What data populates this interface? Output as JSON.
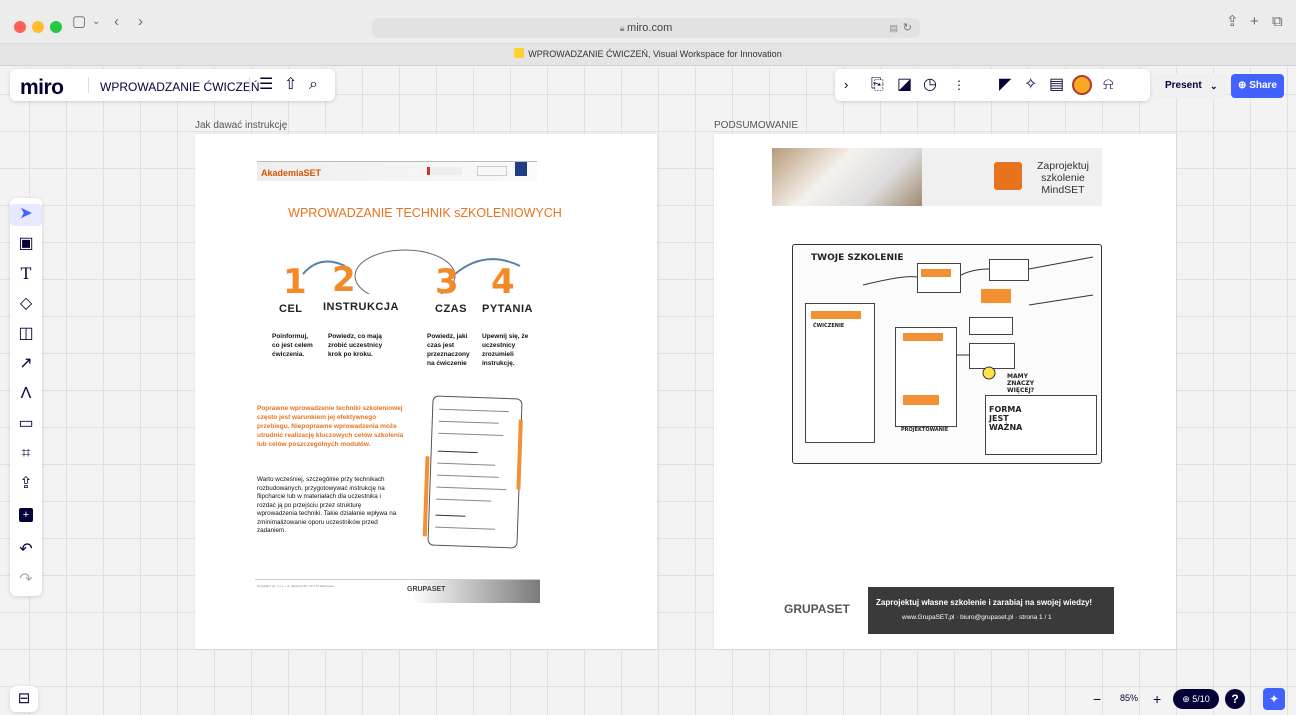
{
  "browser": {
    "url": "miro.com",
    "tab_title": "WPROWADZANIE ĆWICZEŃ, Visual Workspace for Innovation",
    "traffic_colors": [
      "#ff5f57",
      "#febc2e",
      "#28c840"
    ]
  },
  "toolbar": {
    "logo": "miro",
    "board_title": "WPROWADZANIE ĆWICZEŃ",
    "present_label": "Present",
    "share_label": "Share"
  },
  "frames": {
    "left_label": "Jak dawać instrukcję",
    "right_label": "PODSUMOWANIE"
  },
  "left_doc": {
    "akademia": "AkademiaSET",
    "title": "WPROWADZANIE TECHNIK sZKOLENIOWYCH",
    "steps": [
      {
        "num": "1",
        "word": "CEL",
        "desc": "Poinformuj, co jest celem ćwiczenia."
      },
      {
        "num": "2",
        "word": "INSTRUKCJA",
        "desc": "Powiedz, co mają zrobić uczestnicy krok po kroku."
      },
      {
        "num": "3",
        "word": "CZAS",
        "desc": "Powiedz, jaki czas jest przeznaczony na ćwiczenie"
      },
      {
        "num": "4",
        "word": "PYTANIA",
        "desc": "Upewnij się, że uczestnicy zrozumieli instrukcję."
      }
    ],
    "orange_paragraph": "Poprawne wprowadzenie techniki szkoleniowej często jest warunkiem jej efektywnego przebiegu. Niepoprawne wprowadzenia może utrudnić realizację kluczowych celów szkolenia lub celów poszczególnych modułów.",
    "black_paragraph": "Warto wcześniej, szczególnie przy technikach rozbudowanych, przygotowywać instrukcję na flipcharcie lub w materiałach dla uczestnika i rozdać ją po przejściu przez strukturę wprowadzenia techniki. Takie działanie wpływa na zminimalizowanie oporu uczestników przed zadaniem.",
    "footer_text": "GrupaSET sp. z o.o. • ul. Słowicza 90 • 02-170 Warszawa",
    "footer_logo": "GRUPASET"
  },
  "right_doc": {
    "banner_text": "Zaprojektuj szkolenie MindSET",
    "sketch_title": "TWOJE SZKOLENIE",
    "sketch_labels": [
      "ĆWICZENIE",
      "FORMA JEST WAŻNA",
      "MAMY ZNACZY WIĘCEJ?",
      "PROJEKTOWANIE"
    ],
    "footer_logo": "GRUPASET",
    "footer_line1": "Zaprojektuj własne szkolenie i zarabiaj na swojej wiedzy!",
    "footer_line2": "www.GrupaSET.pl  ·  biuro@grupaset.pl  ·  strona 1 / 1"
  },
  "zoom": {
    "level": "85%",
    "pages": "5/10",
    "minus": "−",
    "plus": "+",
    "help": "?"
  },
  "colors": {
    "accent": "#4262ff",
    "orange": "#e8731e",
    "ink": "#050038"
  }
}
